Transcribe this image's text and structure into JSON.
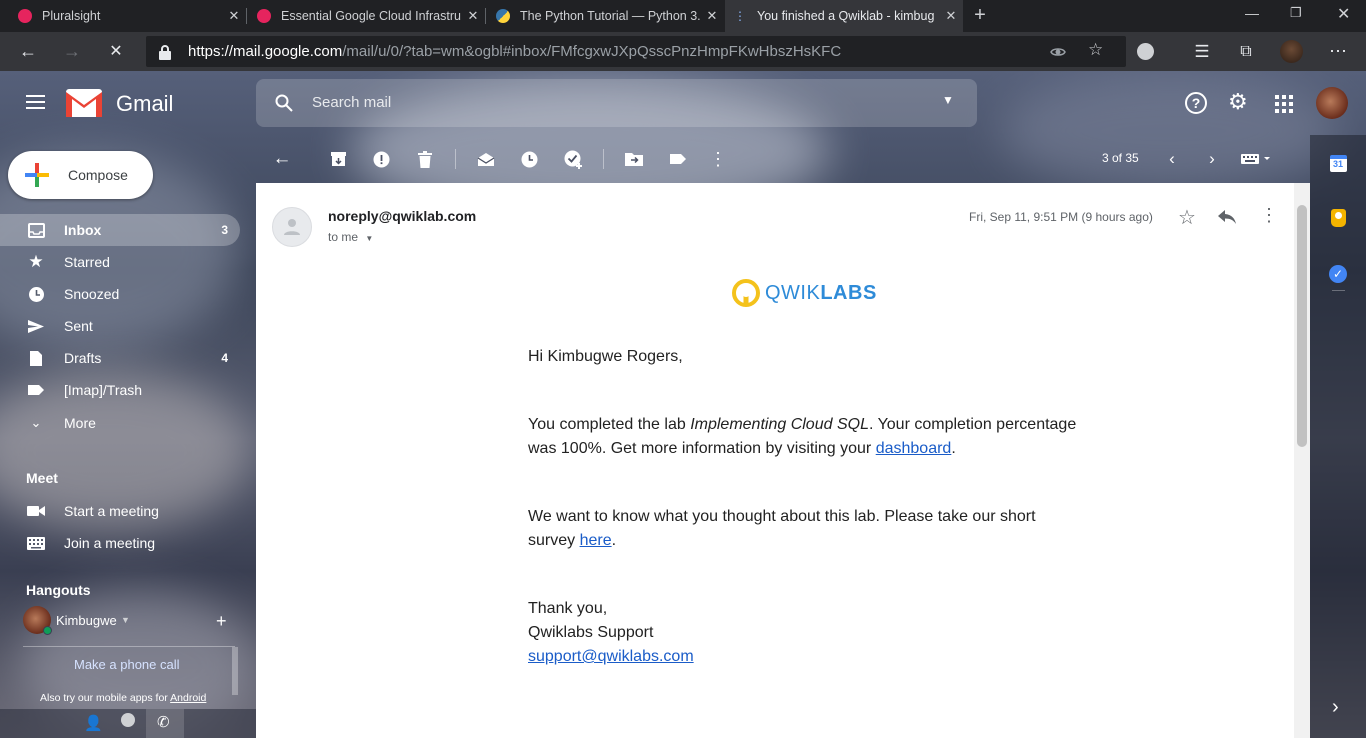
{
  "browser": {
    "tabs": [
      {
        "title": "Pluralsight",
        "favicon_color": "#e6245e"
      },
      {
        "title": "Essential Google Cloud Infrastruc",
        "favicon_color": "#e6245e"
      },
      {
        "title": "The Python Tutorial — Python 3.",
        "favicon_color": "#3776ab"
      },
      {
        "title": "You finished a Qwiklab - kimbug",
        "favicon_color": "#8ab4f8"
      }
    ],
    "url_host": "https://mail.google.com",
    "url_path": "/mail/u/0/?tab=wm&ogbl#inbox/FMfcgxwJXpQsscPnzHmpFKwHbszHsKFC"
  },
  "gmail": {
    "brand": "Gmail",
    "search_placeholder": "Search mail",
    "compose_label": "Compose",
    "nav": [
      {
        "label": "Inbox",
        "count": "3",
        "icon": "inbox-icon"
      },
      {
        "label": "Starred",
        "count": "",
        "icon": "star-icon"
      },
      {
        "label": "Snoozed",
        "count": "",
        "icon": "clock-icon"
      },
      {
        "label": "Sent",
        "count": "",
        "icon": "send-icon"
      },
      {
        "label": "Drafts",
        "count": "4",
        "icon": "draft-icon"
      },
      {
        "label": "[Imap]/Trash",
        "count": "",
        "icon": "label-icon"
      },
      {
        "label": "More",
        "count": "",
        "icon": "chevron-down-icon"
      }
    ],
    "meet": {
      "heading": "Meet",
      "start": "Start a meeting",
      "join": "Join a meeting"
    },
    "hangouts": {
      "heading": "Hangouts",
      "user": "Kimbugwe",
      "phone_call": "Make a phone call",
      "mobile_prefix": "Also try our mobile apps for ",
      "mobile_link": "Android"
    },
    "pager": "3 of 35"
  },
  "email": {
    "sender": "noreply@qwiklab.com",
    "to": "to me",
    "date": "Fri, Sep 11, 9:51 PM (9 hours ago)",
    "logo_light": "QWIK",
    "logo_bold": "LABS",
    "greeting": "Hi Kimbugwe Rogers,",
    "p1_a": "You completed the lab ",
    "p1_lab": "Implementing Cloud SQL",
    "p1_b": ". Your completion percentage",
    "p1_c": "was 100%. Get more information by visiting your ",
    "p1_link": "dashboard",
    "p1_end": ".",
    "p2_a": "We want to know what you thought about this lab. Please take our short",
    "p2_b": "survey ",
    "p2_link": "here",
    "p2_end": ".",
    "sign1": "Thank you,",
    "sign2": "Qwiklabs Support",
    "sign_link": "support@qwiklabs.com"
  }
}
